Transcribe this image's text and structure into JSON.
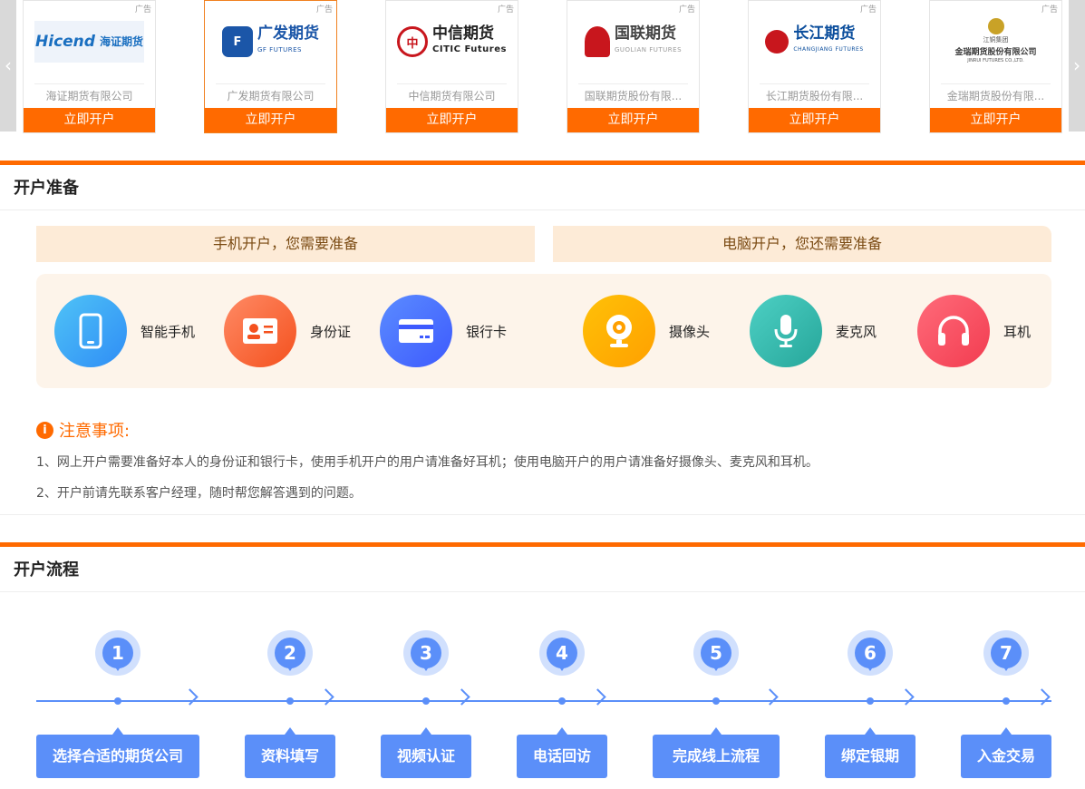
{
  "carousel": {
    "ad_label": "广告",
    "cards": [
      {
        "logo_text": "Hicend",
        "logo_sub": "海证期货",
        "name": "海证期货有限公司",
        "button": "立即开户",
        "color": "#1a6fc0"
      },
      {
        "logo_text": "广发期货",
        "logo_sub": "GF FUTURES",
        "name": "广发期货有限公司",
        "button": "立即开户",
        "color": "#1b56a8"
      },
      {
        "logo_text": "中信期货",
        "logo_sub": "CITIC Futures",
        "name": "中信期货有限公司",
        "button": "立即开户",
        "color": "#c8161d"
      },
      {
        "logo_text": "国联期货",
        "logo_sub": "GUOLIAN FUTURES",
        "name": "国联期货股份有限...",
        "button": "立即开户",
        "color": "#c8161d"
      },
      {
        "logo_text": "长江期货",
        "logo_sub": "CHANGJIANG FUTURES",
        "name": "长江期货股份有限...",
        "button": "立即开户",
        "color": "#0a4d9c"
      },
      {
        "logo_text": "金瑞期货股份有限公司",
        "logo_sub": "JINRUI FUTURES CO.,LTD.",
        "logo_top": "江铜集团",
        "name": "金瑞期货股份有限...",
        "button": "立即开户",
        "color": "#7a5a12"
      }
    ]
  },
  "prep": {
    "title": "开户准备",
    "mobile_heading": "手机开户，您需要准备",
    "pc_heading": "电脑开户，您还需要准备",
    "items": [
      {
        "label": "智能手机",
        "icon": "smartphone-icon",
        "colors": [
          "#4fc3f7",
          "#2f8df5"
        ]
      },
      {
        "label": "身份证",
        "icon": "id-card-icon",
        "colors": [
          "#ff8a65",
          "#f4511e"
        ]
      },
      {
        "label": "银行卡",
        "icon": "bank-card-icon",
        "colors": [
          "#5b8cff",
          "#3d5afe"
        ]
      },
      {
        "label": "摄像头",
        "icon": "webcam-icon",
        "colors": [
          "#ffc107",
          "#ffa000"
        ]
      },
      {
        "label": "麦克风",
        "icon": "microphone-icon",
        "colors": [
          "#4dd0c4",
          "#26a69a"
        ]
      },
      {
        "label": "耳机",
        "icon": "headphones-icon",
        "colors": [
          "#ff6b7a",
          "#f23c50"
        ]
      }
    ],
    "notice_title": "注意事项:",
    "notes": [
      "1、网上开户需要准备好本人的身份证和银行卡，使用手机开户的用户请准备好耳机；使用电脑开户的用户请准备好摄像头、麦克风和耳机。",
      "2、开户前请先联系客户经理，随时帮您解答遇到的问题。"
    ]
  },
  "flow": {
    "title": "开户流程",
    "steps": [
      {
        "num": "1",
        "label": "选择合适的期货公司"
      },
      {
        "num": "2",
        "label": "资料填写"
      },
      {
        "num": "3",
        "label": "视频认证"
      },
      {
        "num": "4",
        "label": "电话回访"
      },
      {
        "num": "5",
        "label": "完成线上流程"
      },
      {
        "num": "6",
        "label": "绑定银期"
      },
      {
        "num": "7",
        "label": "入金交易"
      }
    ]
  },
  "colors": {
    "accent": "#ff6a00",
    "flow_blue": "#5b8ff9"
  }
}
